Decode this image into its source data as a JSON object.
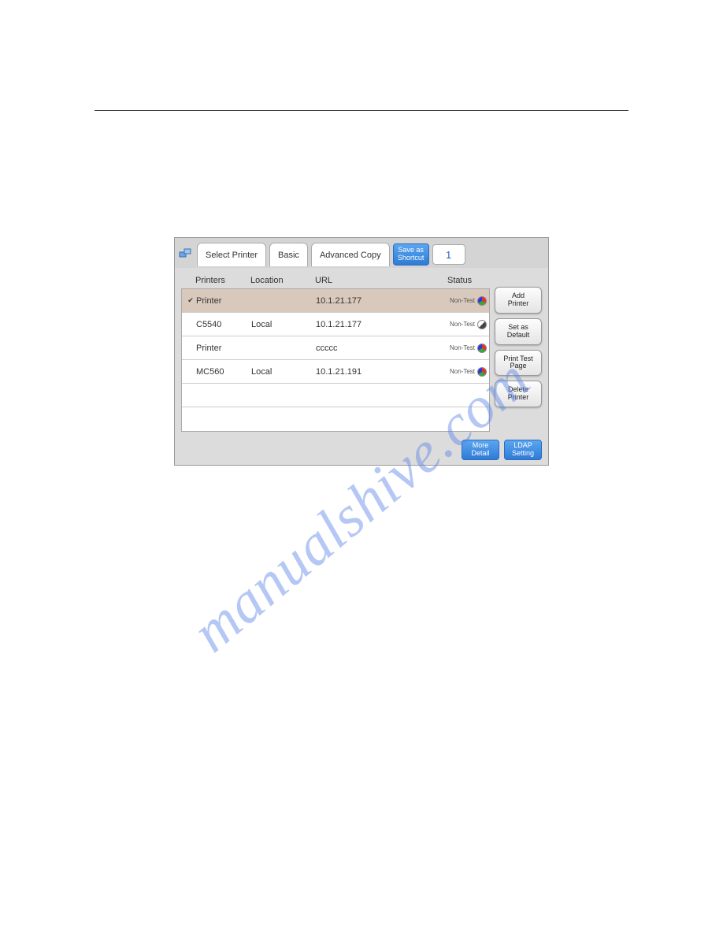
{
  "watermark": "manualshive.com",
  "tabs": {
    "select_printer": "Select Printer",
    "basic": "Basic",
    "advanced_copy": "Advanced Copy",
    "save_as_shortcut": "Save as\nShortcut"
  },
  "copies_value": "1",
  "table": {
    "headers": {
      "printers": "Printers",
      "location": "Location",
      "url": "URL",
      "status": "Status"
    },
    "rows": [
      {
        "selected": true,
        "name": "Printer",
        "location": "",
        "url": "10.1.21.177",
        "status": "Non-Test",
        "colortype": "color"
      },
      {
        "selected": false,
        "name": "C5540",
        "location": "Local",
        "url": "10.1.21.177",
        "status": "Non-Test",
        "colortype": "bw"
      },
      {
        "selected": false,
        "name": "Printer",
        "location": "",
        "url": "ccccc",
        "status": "Non-Test",
        "colortype": "color"
      },
      {
        "selected": false,
        "name": "MC560",
        "location": "Local",
        "url": "10.1.21.191",
        "status": "Non-Test",
        "colortype": "color"
      },
      {
        "selected": false,
        "name": "",
        "location": "",
        "url": "",
        "status": "",
        "colortype": ""
      },
      {
        "selected": false,
        "name": "",
        "location": "",
        "url": "",
        "status": "",
        "colortype": ""
      }
    ]
  },
  "sidebuttons": {
    "add_printer": "Add\nPrinter",
    "set_as_default": "Set as\nDefault",
    "print_test_page": "Print Test\nPage",
    "delete_printer": "Delete\nPrinter"
  },
  "bottom": {
    "more_detail": "More\nDetail",
    "ldap_setting": "LDAP\nSetting"
  }
}
